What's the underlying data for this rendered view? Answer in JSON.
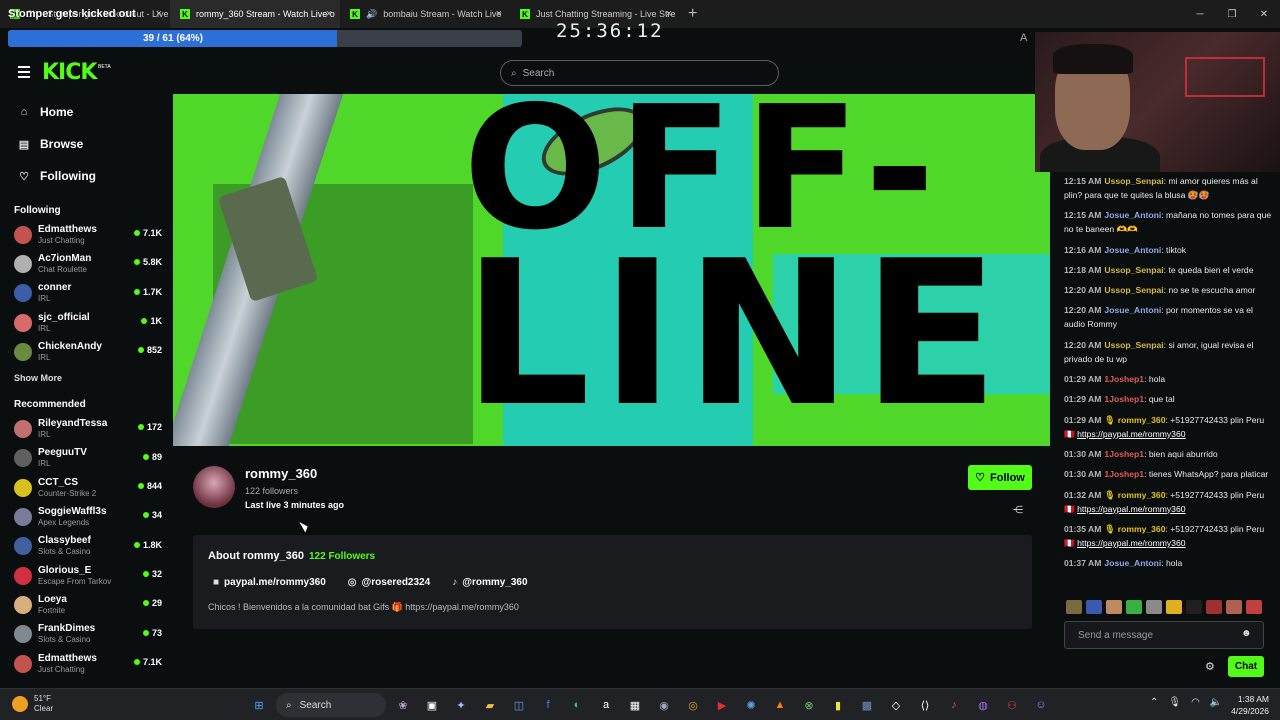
{
  "browser": {
    "overlay_title": "Stomper gets kicked out",
    "tabs": [
      {
        "title": "Ch... Stomper gets kicked out - Live Stre"
      },
      {
        "title": "rommy_360 Stream - Watch Live o"
      },
      {
        "title": "bombaiu Stream - Watch Live"
      },
      {
        "title": "Just Chatting Streaming - Live Stre"
      }
    ],
    "new_tab": "+",
    "close_glyph": "×"
  },
  "progress": {
    "label": "39 / 61 (64%)",
    "fraction": 0.64
  },
  "timer": "25:36:12",
  "header": {
    "logo": "KICK",
    "beta": "BETA",
    "search_placeholder": "Search"
  },
  "nav": [
    {
      "label": "Home",
      "icon": "home-icon"
    },
    {
      "label": "Browse",
      "icon": "browse-icon"
    },
    {
      "label": "Following",
      "icon": "heart-icon"
    }
  ],
  "following": {
    "title": "Following",
    "channels": [
      {
        "name": "Edmatthews",
        "category": "Just Chatting",
        "viewers": "7.1K",
        "color": "#c4534d"
      },
      {
        "name": "Ac7ionMan",
        "category": "Chat Roulette",
        "viewers": "5.8K",
        "color": "#b0b0b0"
      },
      {
        "name": "conner",
        "category": "IRL",
        "viewers": "1.7K",
        "color": "#3a5fa8"
      },
      {
        "name": "sjc_official",
        "category": "IRL",
        "viewers": "1K",
        "color": "#d86a6a"
      },
      {
        "name": "ChickenAndy",
        "category": "IRL",
        "viewers": "852",
        "color": "#6a8a40"
      }
    ],
    "show_more": "Show More"
  },
  "recommended": {
    "title": "Recommended",
    "channels": [
      {
        "name": "RileyandTessa",
        "category": "IRL",
        "viewers": "172",
        "color": "#c07070"
      },
      {
        "name": "PeeguuTV",
        "category": "IRL",
        "viewers": "89",
        "color": "#606060"
      },
      {
        "name": "CCT_CS",
        "category": "Counter-Strike 2",
        "viewers": "844",
        "color": "#d8c020"
      },
      {
        "name": "SoggieWaffl3s",
        "category": "Apex Legends",
        "viewers": "34",
        "color": "#7a7a9a"
      },
      {
        "name": "Classybeef",
        "category": "Slots & Casino",
        "viewers": "1.8K",
        "color": "#4060a0"
      },
      {
        "name": "Glorious_E",
        "category": "Escape From Tarkov",
        "viewers": "32",
        "color": "#d03040"
      },
      {
        "name": "Loeya",
        "category": "Fortnite",
        "viewers": "29",
        "color": "#d8b080"
      },
      {
        "name": "FrankDimes",
        "category": "Slots & Casino",
        "viewers": "73",
        "color": "#808890"
      },
      {
        "name": "Edmatthews",
        "category": "Just Chatting",
        "viewers": "7.1K",
        "color": "#c4534d"
      }
    ]
  },
  "banner": {
    "line1": "OFF-",
    "line2": "LINE"
  },
  "channel": {
    "name": "rommy_360",
    "followers": "122 followers",
    "last_live": "Last live 3 minutes ago",
    "follow_label": "Follow"
  },
  "about": {
    "title": "About rommy_360",
    "followers": "122 Followers",
    "links": [
      {
        "label": "paypal.me/rommy360",
        "icon": "paypal-icon",
        "glyph": "■"
      },
      {
        "label": "@rosered2324",
        "icon": "instagram-icon",
        "glyph": "◎"
      },
      {
        "label": "@rommy_360",
        "icon": "tiktok-icon",
        "glyph": "♪"
      }
    ],
    "description": "Chicos ! Bienvenidos a la comunidad bat Gifs 🎁 https://paypal.me/rommy360"
  },
  "chat": {
    "messages": [
      {
        "time": "12:15 AM",
        "user": "Ussop_Senpai",
        "color": "#d4b84a",
        "text": "mi amor quieres más al plin? para que te quites la blusa 🥵🥵",
        "link": ""
      },
      {
        "time": "12:15 AM",
        "user": "Josue_Antoni",
        "color": "#8fa8e8",
        "text": "mañana no tomes para que no te baneen 🫶🫶",
        "link": ""
      },
      {
        "time": "12:16 AM",
        "user": "Josue_Antoni",
        "color": "#8fa8e8",
        "text": "tiktok",
        "link": ""
      },
      {
        "time": "12:18 AM",
        "user": "Ussop_Senpai",
        "color": "#d4b84a",
        "text": "te queda bien el verde",
        "link": ""
      },
      {
        "time": "12:20 AM",
        "user": "Ussop_Senpai",
        "color": "#d4b84a",
        "text": "no se te escucha amor",
        "link": ""
      },
      {
        "time": "12:20 AM",
        "user": "Josue_Antoni",
        "color": "#8fa8e8",
        "text": "por momentos se va el audio Rommy",
        "link": ""
      },
      {
        "time": "12:20 AM",
        "user": "Ussop_Senpai",
        "color": "#d4b84a",
        "text": "si amor, igual revisa el privado de tu wp",
        "link": ""
      },
      {
        "time": "01:29 AM",
        "user": "1Joshep1",
        "color": "#e05a5a",
        "text": "hola",
        "link": ""
      },
      {
        "time": "01:29 AM",
        "user": "1Joshep1",
        "color": "#e05a5a",
        "text": "que tal",
        "link": ""
      },
      {
        "time": "01:29 AM",
        "user": "🎙 rommy_360",
        "color": "#e8c020",
        "text": "+51927742433 plin Peru 🇵🇪",
        "link": "https://paypal.me/rommy360"
      },
      {
        "time": "01:30 AM",
        "user": "1Joshep1",
        "color": "#e05a5a",
        "text": "bien aqui aburrido",
        "link": ""
      },
      {
        "time": "01:30 AM",
        "user": "1Joshep1",
        "color": "#e05a5a",
        "text": "tienes WhatsApp? para platicar",
        "link": ""
      },
      {
        "time": "01:32 AM",
        "user": "🎙 rommy_360",
        "color": "#e8c020",
        "text": "+51927742433 plin Peru 🇵🇪",
        "link": "https://paypal.me/rommy360"
      },
      {
        "time": "01:35 AM",
        "user": "🎙 rommy_360",
        "color": "#e8c020",
        "text": "+51927742433 plin Peru 🇵🇪",
        "link": "https://paypal.me/rommy360"
      },
      {
        "time": "01:37 AM",
        "user": "Josue_Antoni",
        "color": "#8fa8e8",
        "text": "hola",
        "link": ""
      }
    ],
    "input_placeholder": "Send a message",
    "chat_button": "Chat"
  },
  "taskbar": {
    "temperature": "51°F",
    "condition": "Clear",
    "search": "Search",
    "time": "1:38 AM",
    "date": "4/29/2026"
  }
}
